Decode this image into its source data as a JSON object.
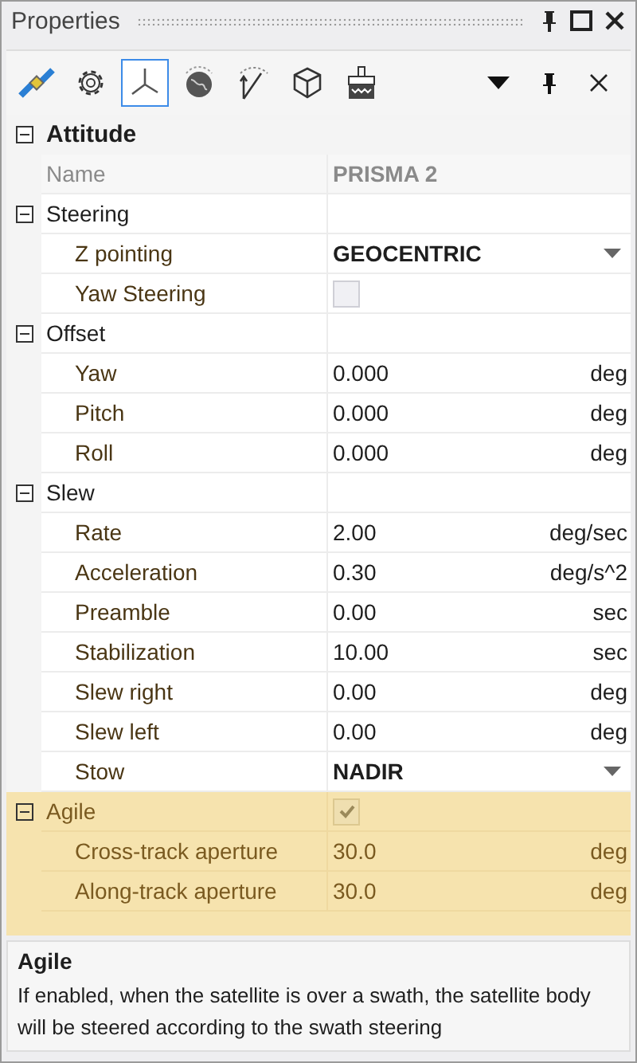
{
  "panel": {
    "title": "Properties"
  },
  "toolbar": {
    "tools": [
      {
        "kind": "satellite",
        "selected": false
      },
      {
        "kind": "gear",
        "selected": false
      },
      {
        "kind": "axes",
        "selected": true
      },
      {
        "kind": "globe",
        "selected": false
      },
      {
        "kind": "trajectory",
        "selected": false
      },
      {
        "kind": "cube",
        "selected": false
      },
      {
        "kind": "brush",
        "selected": false
      }
    ]
  },
  "grid": {
    "category": {
      "title": "Attitude",
      "expanded": true
    },
    "rows": [
      {
        "kind": "text",
        "label": "Name",
        "value": "PRISMA 2",
        "readonly": true
      },
      {
        "kind": "group",
        "label": "Steering",
        "expanded": true,
        "selected": false,
        "children": [
          {
            "kind": "dropdown",
            "label": "Z pointing",
            "value": "GEOCENTRIC"
          },
          {
            "kind": "checkbox",
            "label": "Yaw Steering",
            "checked": false
          }
        ]
      },
      {
        "kind": "group",
        "label": "Offset",
        "expanded": true,
        "selected": false,
        "children": [
          {
            "kind": "text",
            "label": "Yaw",
            "value": "0.000",
            "unit": "deg"
          },
          {
            "kind": "text",
            "label": "Pitch",
            "value": "0.000",
            "unit": "deg"
          },
          {
            "kind": "text",
            "label": "Roll",
            "value": "0.000",
            "unit": "deg"
          }
        ]
      },
      {
        "kind": "group",
        "label": "Slew",
        "expanded": true,
        "selected": false,
        "children": [
          {
            "kind": "text",
            "label": "Rate",
            "value": "2.00",
            "unit": "deg/sec"
          },
          {
            "kind": "text",
            "label": "Acceleration",
            "value": "0.30",
            "unit": "deg/s^2"
          },
          {
            "kind": "text",
            "label": "Preamble",
            "value": "0.00",
            "unit": "sec"
          },
          {
            "kind": "text",
            "label": "Stabilization",
            "value": "10.00",
            "unit": "sec"
          },
          {
            "kind": "text",
            "label": "Slew right",
            "value": "0.00",
            "unit": "deg"
          },
          {
            "kind": "text",
            "label": "Slew left",
            "value": "0.00",
            "unit": "deg"
          },
          {
            "kind": "dropdown",
            "label": "Stow",
            "value": "NADIR"
          }
        ]
      },
      {
        "kind": "group",
        "label": "Agile",
        "expanded": true,
        "selected": true,
        "checked": true,
        "children": [
          {
            "kind": "text",
            "label": "Cross-track aperture",
            "value": "30.0",
            "unit": "deg"
          },
          {
            "kind": "text",
            "label": "Along-track aperture",
            "value": "30.0",
            "unit": "deg"
          }
        ]
      }
    ]
  },
  "description": {
    "title": "Agile",
    "text": "If enabled, when the satellite is over a swath, the satellite body will be steered according to the swath steering"
  }
}
